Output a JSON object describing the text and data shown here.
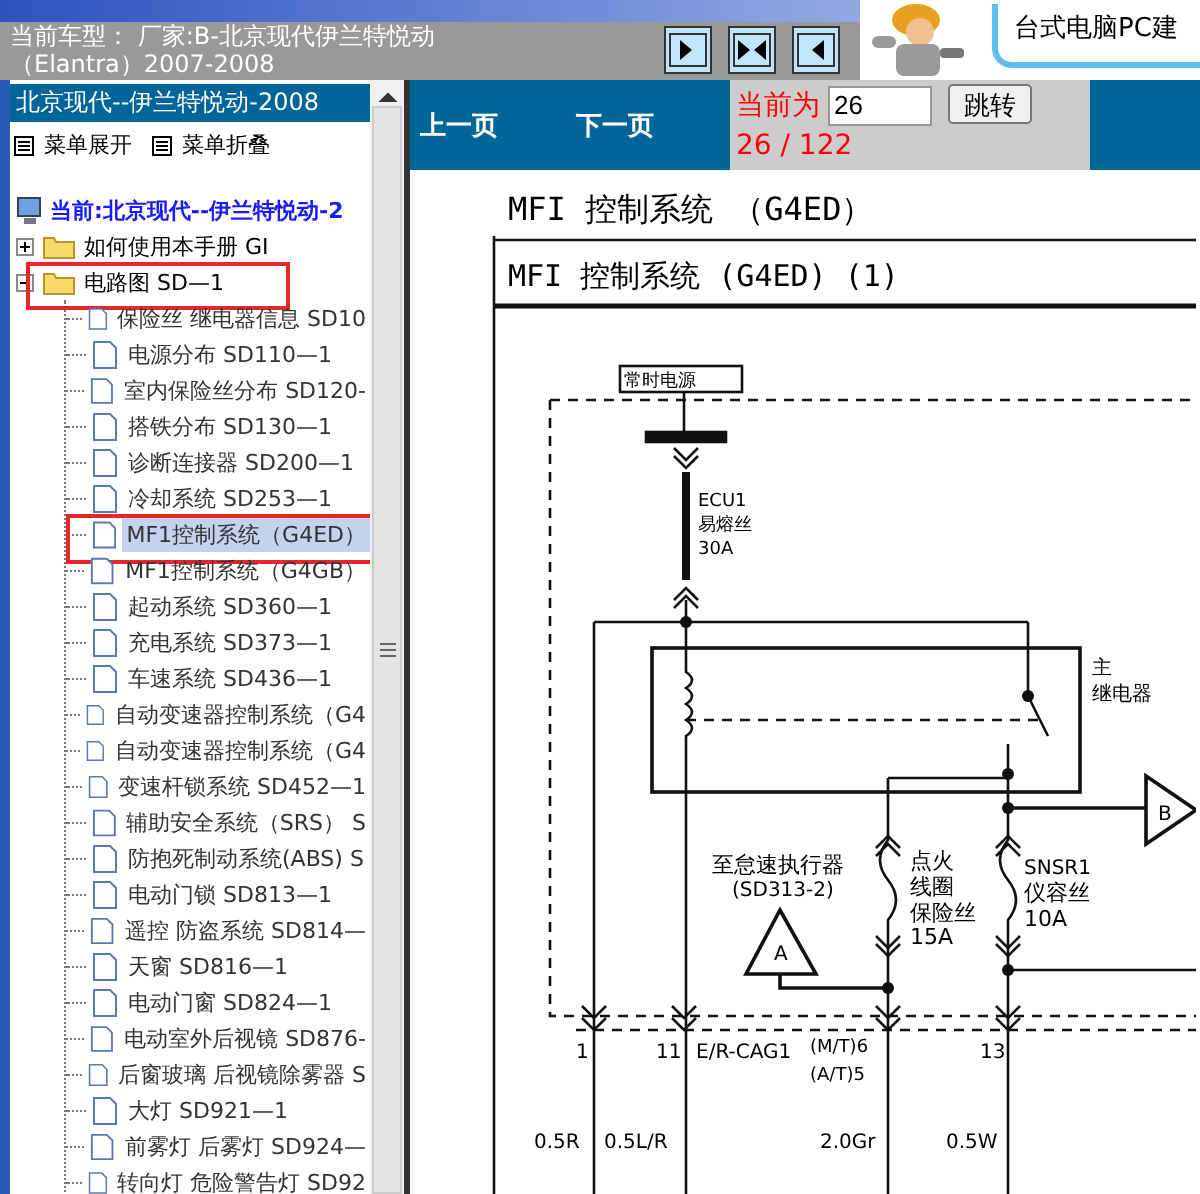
{
  "header": {
    "car_model": "当前车型： 厂家:B-北京现代伊兰特悦动",
    "car_model_line2": "（Elantra）2007-2008",
    "toolbar_buttons": [
      {
        "kind": "right"
      },
      {
        "kind": "both"
      },
      {
        "kind": "left"
      }
    ],
    "ad_text": "台式电脑PC建"
  },
  "sidebar": {
    "title": "北京现代--伊兰特悦动-2008",
    "menu": [
      "菜单展开",
      "菜单折叠"
    ],
    "tree": {
      "label": "当前:北京现代--伊兰特悦动-2",
      "children": [
        {
          "label": "如何使用本手册 GI",
          "expanded": false,
          "marked": false
        },
        {
          "label": "电路图 SD—1",
          "expanded": true,
          "marked": true,
          "children": [
            {
              "label": "保险丝 继电器信息 SD10",
              "selected": false,
              "marked": false
            },
            {
              "label": "电源分布 SD110—1",
              "selected": false,
              "marked": false
            },
            {
              "label": "室内保险丝分布 SD120-",
              "selected": false,
              "marked": false
            },
            {
              "label": "搭铁分布 SD130—1",
              "selected": false,
              "marked": false
            },
            {
              "label": "诊断连接器 SD200—1",
              "selected": false,
              "marked": false
            },
            {
              "label": "冷却系统 SD253—1",
              "selected": false,
              "marked": false
            },
            {
              "label": "MF1控制系统（G4ED）",
              "selected": true,
              "marked": true
            },
            {
              "label": "MF1控制系统（G4GB）",
              "selected": false,
              "marked": false
            },
            {
              "label": "起动系统 SD360—1",
              "selected": false,
              "marked": false
            },
            {
              "label": "充电系统 SD373—1",
              "selected": false,
              "marked": false
            },
            {
              "label": "车速系统 SD436—1",
              "selected": false,
              "marked": false
            },
            {
              "label": "自动变速器控制系统（G4",
              "selected": false,
              "marked": false
            },
            {
              "label": "自动变速器控制系统（G4",
              "selected": false,
              "marked": false
            },
            {
              "label": "变速杆锁系统 SD452—1",
              "selected": false,
              "marked": false
            },
            {
              "label": "辅助安全系统（SRS） S",
              "selected": false,
              "marked": false
            },
            {
              "label": "防抱死制动系统(ABS) S",
              "selected": false,
              "marked": false
            },
            {
              "label": "电动门锁 SD813—1",
              "selected": false,
              "marked": false
            },
            {
              "label": "遥控 防盗系统 SD814—",
              "selected": false,
              "marked": false
            },
            {
              "label": "天窗 SD816—1",
              "selected": false,
              "marked": false
            },
            {
              "label": "电动门窗 SD824—1",
              "selected": false,
              "marked": false
            },
            {
              "label": "电动室外后视镜 SD876-",
              "selected": false,
              "marked": false
            },
            {
              "label": "后窗玻璃 后视镜除雾器 S",
              "selected": false,
              "marked": false
            },
            {
              "label": "大灯 SD921—1",
              "selected": false,
              "marked": false
            },
            {
              "label": "前雾灯 后雾灯 SD924—",
              "selected": false,
              "marked": false
            },
            {
              "label": "转向灯 危险警告灯 SD92",
              "selected": false,
              "marked": false
            }
          ]
        }
      ]
    }
  },
  "viewer": {
    "prev": "上一页",
    "next": "下一页",
    "current_label": "当前为",
    "page_input": "26",
    "go_button": "跳转",
    "page_count": "26 / 122",
    "page_title": "MFI 控制系统 （G4ED）",
    "sheet_title": "MFI 控制系统 (G4ED) (1)",
    "diagram_labels": [
      "常时电源",
      "ECU1",
      "易熔丝",
      "30A",
      "主",
      "继电器",
      "至怠速执行器",
      "(SD313-2)",
      "A",
      "点火",
      "线圈",
      "保险丝",
      "15A",
      "SNSR1",
      "仪容丝",
      "10A",
      "B",
      "1",
      "11",
      "E/R-CAG1",
      "(M/T)6",
      "(A/T)5",
      "13",
      "0.5R",
      "0.5L/R",
      "2.0Gr",
      "0.5W"
    ]
  }
}
